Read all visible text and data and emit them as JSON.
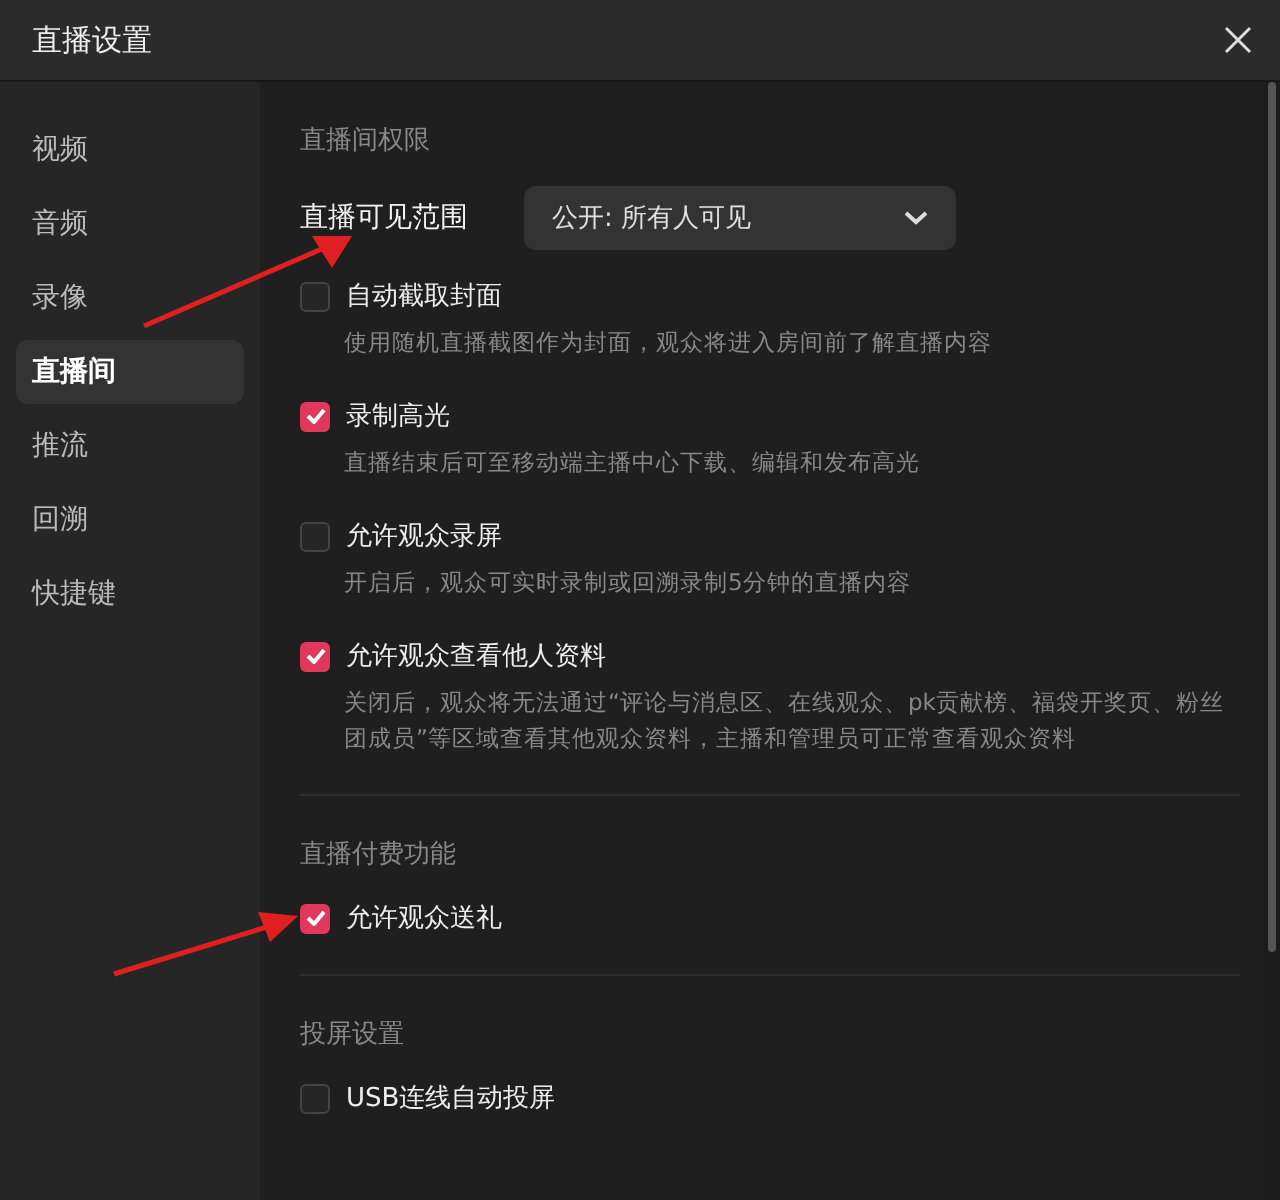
{
  "window": {
    "title": "直播设置"
  },
  "sidebar": {
    "items": [
      {
        "label": "视频",
        "selected": false
      },
      {
        "label": "音频",
        "selected": false
      },
      {
        "label": "录像",
        "selected": false
      },
      {
        "label": "直播间",
        "selected": true
      },
      {
        "label": "推流",
        "selected": false
      },
      {
        "label": "回溯",
        "selected": false
      },
      {
        "label": "快捷键",
        "selected": false
      }
    ]
  },
  "sections": [
    {
      "title": "直播间权限",
      "items": [
        {
          "kind": "select",
          "label": "直播可见范围",
          "value": "公开: 所有人可见"
        },
        {
          "kind": "checkbox",
          "label": "自动截取封面",
          "checked": false,
          "description": "使用随机直播截图作为封面，观众将进入房间前了解直播内容"
        },
        {
          "kind": "checkbox",
          "label": "录制高光",
          "checked": true,
          "description": "直播结束后可至移动端主播中心下载、编辑和发布高光"
        },
        {
          "kind": "checkbox",
          "label": "允许观众录屏",
          "checked": false,
          "description": "开启后，观众可实时录制或回溯录制5分钟的直播内容"
        },
        {
          "kind": "checkbox",
          "label": "允许观众查看他人资料",
          "checked": true,
          "description": "关闭后，观众将无法通过“评论与消息区、在线观众、pk贡献榜、福袋开奖页、粉丝团成员”等区域查看其他观众资料，主播和管理员可正常查看观众资料"
        }
      ]
    },
    {
      "title": "直播付费功能",
      "items": [
        {
          "kind": "checkbox",
          "label": "允许观众送礼",
          "checked": true
        }
      ]
    },
    {
      "title": "投屏设置",
      "items": [
        {
          "kind": "checkbox",
          "label": "USB连线自动投屏",
          "checked": false
        }
      ]
    }
  ]
}
